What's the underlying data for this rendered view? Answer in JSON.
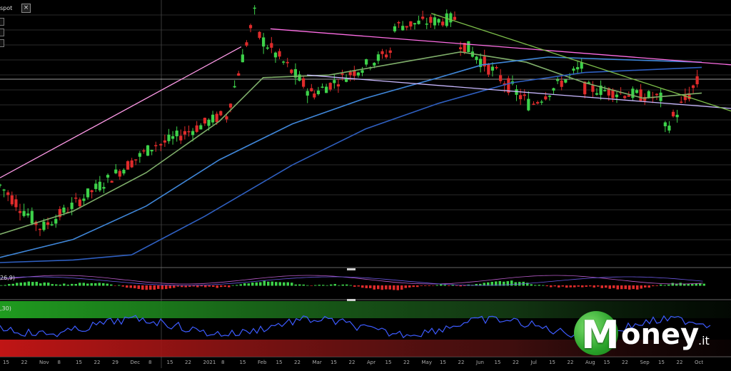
{
  "header": {
    "instrument_fragment": "spot",
    "close_label": "×"
  },
  "indicators": {
    "macd_label": "26,9)",
    "rsi_label": ",30)"
  },
  "watermark": {
    "brand_first": "M",
    "brand_rest": "oney",
    "brand_tld": ".it",
    "brand_color": "#2aa22a"
  },
  "colors": {
    "bull": "#3dd24a",
    "bear": "#e02b2b",
    "ma_fast": "#7fae6a",
    "ma_mid": "#3f86d8",
    "ma_slow": "#2f5fc0",
    "channel_top": "#ff6ee6",
    "channel_bottom": "#c9b8ff",
    "trend": "#ff9ae8",
    "down_trend": "#7dbf4a"
  },
  "x_ticks": [
    "15",
    "22",
    "Nov",
    "8",
    "15",
    "22",
    "29",
    "Dec",
    "8",
    "15",
    "22",
    "2021",
    "8",
    "15",
    "Feb",
    "15",
    "22",
    "Mar",
    "15",
    "22",
    "Apr",
    "15",
    "22",
    "May",
    "15",
    "22",
    "Jun",
    "15",
    "22",
    "Jul",
    "15",
    "22",
    "Aug",
    "15",
    "22",
    "Sep",
    "15",
    "22",
    "Oct"
  ],
  "chart_data": {
    "type": "candlestick",
    "title": "",
    "xlabel": "",
    "ylabel": "",
    "grid": true,
    "y_range_norm": [
      0,
      1
    ],
    "note_units": "price levels normalized to 0–1 of visible main-panel range",
    "candles_per_segment": [
      {
        "from": 0.0,
        "to": 0.06,
        "start": 0.3,
        "end": 0.14,
        "vol": 0.06
      },
      {
        "from": 0.06,
        "to": 0.22,
        "start": 0.14,
        "end": 0.46,
        "vol": 0.05
      },
      {
        "from": 0.22,
        "to": 0.31,
        "start": 0.46,
        "end": 0.57,
        "vol": 0.05
      },
      {
        "from": 0.31,
        "to": 0.355,
        "start": 0.57,
        "end": 0.97,
        "vol": 0.05
      },
      {
        "from": 0.355,
        "to": 0.43,
        "start": 0.88,
        "end": 0.66,
        "vol": 0.06
      },
      {
        "from": 0.43,
        "to": 0.54,
        "start": 0.66,
        "end": 0.82,
        "vol": 0.05
      },
      {
        "from": 0.54,
        "to": 0.63,
        "start": 0.92,
        "end": 0.95,
        "vol": 0.05
      },
      {
        "from": 0.63,
        "to": 0.73,
        "start": 0.86,
        "end": 0.62,
        "vol": 0.06
      },
      {
        "from": 0.73,
        "to": 0.8,
        "start": 0.62,
        "end": 0.76,
        "vol": 0.05
      },
      {
        "from": 0.8,
        "to": 0.91,
        "start": 0.68,
        "end": 0.64,
        "vol": 0.05
      },
      {
        "from": 0.91,
        "to": 0.96,
        "start": 0.52,
        "end": 0.7,
        "vol": 0.06
      }
    ],
    "moving_averages": [
      {
        "name": "",
        "color_key": "ma_fast",
        "points": [
          [
            0.0,
            0.11
          ],
          [
            0.1,
            0.2
          ],
          [
            0.2,
            0.35
          ],
          [
            0.3,
            0.55
          ],
          [
            0.36,
            0.72
          ],
          [
            0.45,
            0.73
          ],
          [
            0.55,
            0.78
          ],
          [
            0.63,
            0.82
          ],
          [
            0.72,
            0.78
          ],
          [
            0.8,
            0.7
          ],
          [
            0.88,
            0.64
          ],
          [
            0.96,
            0.66
          ]
        ]
      },
      {
        "name": "",
        "color_key": "ma_mid",
        "points": [
          [
            0.0,
            0.02
          ],
          [
            0.1,
            0.09
          ],
          [
            0.2,
            0.22
          ],
          [
            0.3,
            0.4
          ],
          [
            0.4,
            0.54
          ],
          [
            0.5,
            0.64
          ],
          [
            0.6,
            0.72
          ],
          [
            0.66,
            0.77
          ],
          [
            0.75,
            0.8
          ],
          [
            0.85,
            0.79
          ],
          [
            0.96,
            0.78
          ]
        ]
      },
      {
        "name": "",
        "color_key": "ma_slow",
        "points": [
          [
            0.0,
            0.0
          ],
          [
            0.1,
            0.01
          ],
          [
            0.18,
            0.03
          ],
          [
            0.28,
            0.18
          ],
          [
            0.4,
            0.38
          ],
          [
            0.5,
            0.52
          ],
          [
            0.6,
            0.62
          ],
          [
            0.7,
            0.7
          ],
          [
            0.8,
            0.74
          ],
          [
            0.96,
            0.76
          ]
        ]
      }
    ],
    "trendlines": [
      {
        "color_key": "trend",
        "from": [
          0.0,
          0.33
        ],
        "to": [
          0.33,
          0.84
        ]
      },
      {
        "color_key": "channel_top",
        "from": [
          0.37,
          0.91
        ],
        "to": [
          1.0,
          0.77
        ]
      },
      {
        "color_key": "channel_bottom",
        "from": [
          0.42,
          0.73
        ],
        "to": [
          1.0,
          0.6
        ]
      },
      {
        "color_key": "down_trend",
        "from": [
          0.59,
          0.97
        ],
        "to": [
          1.0,
          0.59
        ]
      }
    ]
  }
}
